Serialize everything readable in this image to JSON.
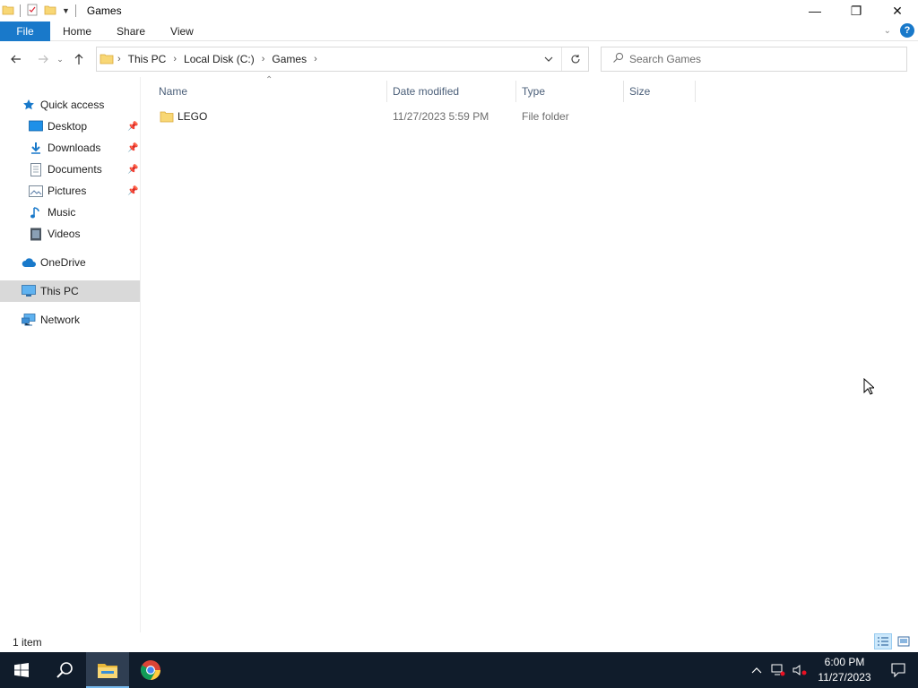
{
  "window": {
    "title": "Games",
    "controls": {
      "minimize": "—",
      "maximize": "❐",
      "close": "✕"
    }
  },
  "ribbon": {
    "tabs": [
      "File",
      "Home",
      "Share",
      "View"
    ]
  },
  "navigation": {
    "breadcrumb": [
      "This PC",
      "Local Disk (C:)",
      "Games"
    ],
    "search_placeholder": "Search Games"
  },
  "sidebar": {
    "items": [
      {
        "label": "Quick access",
        "icon": "star-icon"
      },
      {
        "label": "Desktop",
        "icon": "desktop-icon",
        "pinned": true
      },
      {
        "label": "Downloads",
        "icon": "download-icon",
        "pinned": true
      },
      {
        "label": "Documents",
        "icon": "document-icon",
        "pinned": true
      },
      {
        "label": "Pictures",
        "icon": "picture-icon",
        "pinned": true
      },
      {
        "label": "Music",
        "icon": "music-icon"
      },
      {
        "label": "Videos",
        "icon": "video-icon"
      },
      {
        "label": "OneDrive",
        "icon": "cloud-icon"
      },
      {
        "label": "This PC",
        "icon": "computer-icon",
        "selected": true
      },
      {
        "label": "Network",
        "icon": "network-icon"
      }
    ]
  },
  "file_list": {
    "columns": [
      "Name",
      "Date modified",
      "Type",
      "Size"
    ],
    "rows": [
      {
        "name": "LEGO",
        "date_modified": "11/27/2023 5:59 PM",
        "type": "File folder",
        "size": ""
      }
    ]
  },
  "status_bar": {
    "item_count": "1 item"
  },
  "taskbar": {
    "apps": [
      "start-icon",
      "search-icon",
      "file-explorer-icon",
      "chrome-icon"
    ],
    "clock_time": "6:00 PM",
    "clock_date": "11/27/2023"
  },
  "colors": {
    "accent": "#1979ca",
    "taskbar": "#101c2b",
    "folder": "#f8d775",
    "selected_row": "#d9d9d9"
  }
}
